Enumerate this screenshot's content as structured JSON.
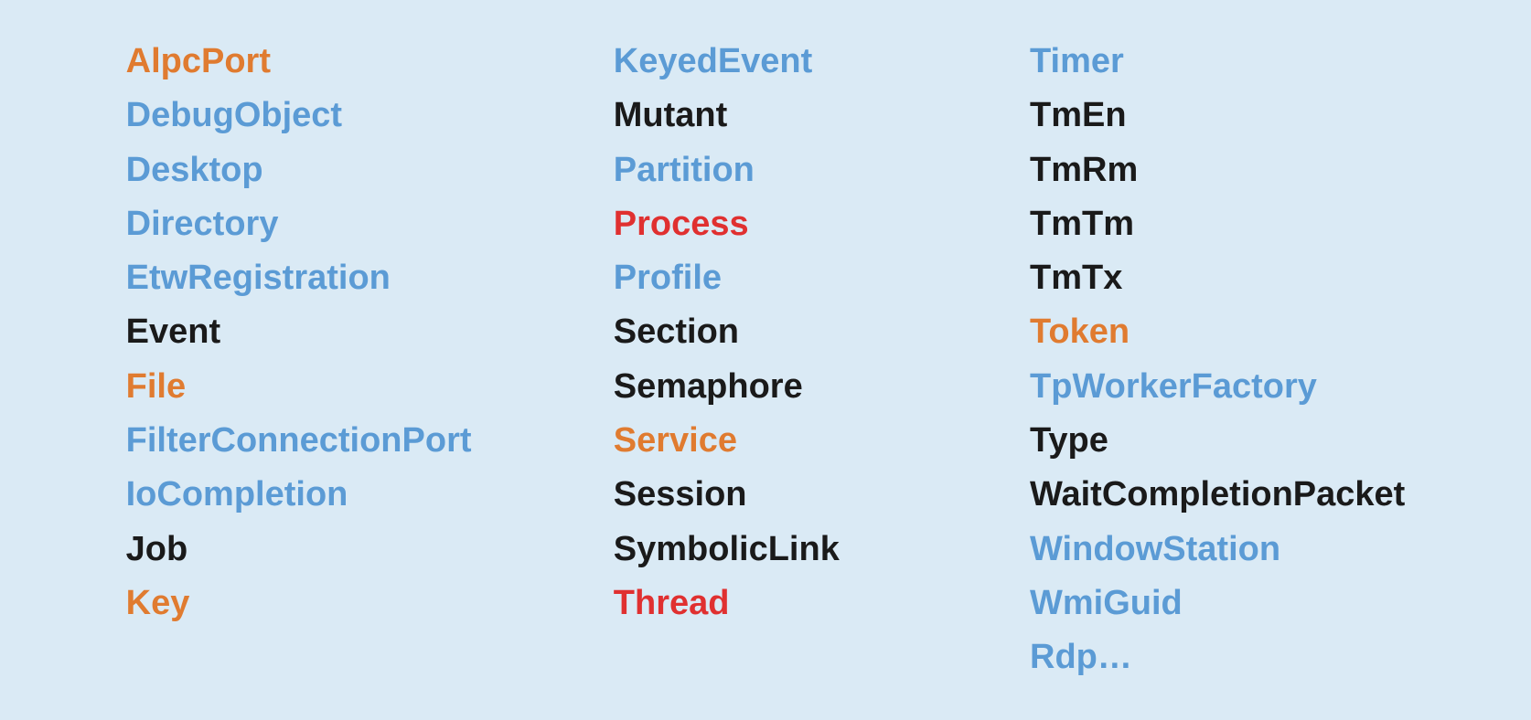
{
  "columns": [
    {
      "id": "col1",
      "items": [
        {
          "label": "AlpcPort",
          "color": "orange"
        },
        {
          "label": "DebugObject",
          "color": "blue"
        },
        {
          "label": "Desktop",
          "color": "blue"
        },
        {
          "label": "Directory",
          "color": "blue"
        },
        {
          "label": "EtwRegistration",
          "color": "blue"
        },
        {
          "label": "Event",
          "color": "black"
        },
        {
          "label": "File",
          "color": "orange"
        },
        {
          "label": "FilterConnectionPort",
          "color": "blue"
        },
        {
          "label": "IoCompletion",
          "color": "blue"
        },
        {
          "label": "Job",
          "color": "black"
        },
        {
          "label": "Key",
          "color": "orange"
        }
      ]
    },
    {
      "id": "col2",
      "items": [
        {
          "label": "KeyedEvent",
          "color": "blue"
        },
        {
          "label": "Mutant",
          "color": "black"
        },
        {
          "label": "Partition",
          "color": "blue"
        },
        {
          "label": "Process",
          "color": "red"
        },
        {
          "label": "Profile",
          "color": "blue"
        },
        {
          "label": "Section",
          "color": "black"
        },
        {
          "label": "Semaphore",
          "color": "black"
        },
        {
          "label": "Service",
          "color": "orange"
        },
        {
          "label": "Session",
          "color": "black"
        },
        {
          "label": "SymbolicLink",
          "color": "black"
        },
        {
          "label": "Thread",
          "color": "red"
        }
      ]
    },
    {
      "id": "col3",
      "items": [
        {
          "label": "Timer",
          "color": "blue"
        },
        {
          "label": "TmEn",
          "color": "black"
        },
        {
          "label": "TmRm",
          "color": "black"
        },
        {
          "label": "TmTm",
          "color": "black"
        },
        {
          "label": "TmTx",
          "color": "black"
        },
        {
          "label": "Token",
          "color": "orange"
        },
        {
          "label": "TpWorkerFactory",
          "color": "blue"
        },
        {
          "label": "Type",
          "color": "black"
        },
        {
          "label": "WaitCompletionPacket",
          "color": "black"
        },
        {
          "label": "WindowStation",
          "color": "blue"
        },
        {
          "label": "WmiGuid",
          "color": "blue"
        },
        {
          "label": "Rdp…",
          "color": "blue"
        }
      ]
    }
  ],
  "colors": {
    "orange": "#e07b30",
    "blue": "#5b9bd5",
    "black": "#1a1a1a",
    "red": "#e03030"
  }
}
